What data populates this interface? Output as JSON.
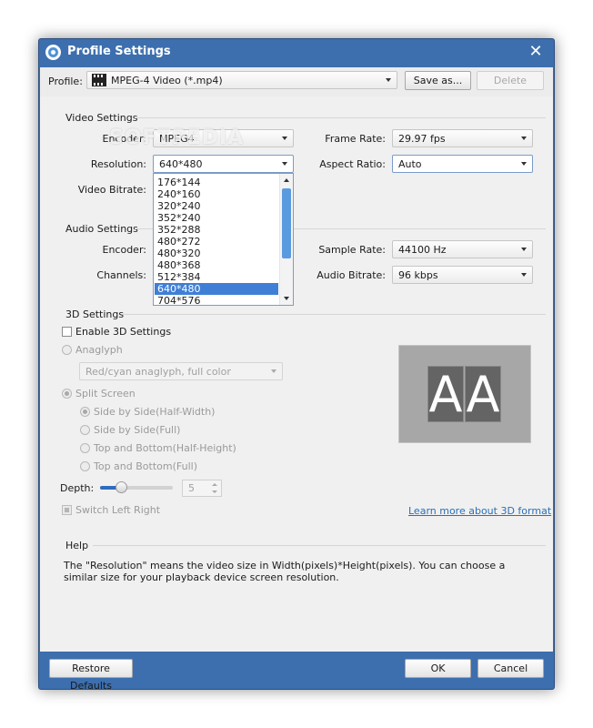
{
  "window": {
    "title": "Profile Settings",
    "close_glyph": "✕"
  },
  "profile": {
    "label": "Profile:",
    "value": "MPEG-4 Video (*.mp4)",
    "save_as": "Save as...",
    "delete": "Delete"
  },
  "video": {
    "section_title": "Video Settings",
    "encoder_label": "Encoder:",
    "encoder_value": "MPEG4",
    "resolution_label": "Resolution:",
    "resolution_value": "640*480",
    "bitrate_label": "Video Bitrate:",
    "frame_rate_label": "Frame Rate:",
    "frame_rate_value": "29.97 fps",
    "aspect_label": "Aspect Ratio:",
    "aspect_value": "Auto"
  },
  "resolution_dropdown": {
    "options": [
      "176*144",
      "240*160",
      "320*240",
      "352*240",
      "352*288",
      "480*272",
      "480*320",
      "480*368",
      "512*384",
      "640*480",
      "704*576"
    ],
    "selected": "640*480"
  },
  "audio": {
    "section_title": "Audio Settings",
    "encoder_label": "Encoder:",
    "channels_label": "Channels:",
    "sample_rate_label": "Sample Rate:",
    "sample_rate_value": "44100 Hz",
    "bitrate_label": "Audio Bitrate:",
    "bitrate_value": "96 kbps"
  },
  "three_d": {
    "section_title": "3D Settings",
    "enable_label": "Enable 3D Settings",
    "anaglyph_label": "Anaglyph",
    "anaglyph_value": "Red/cyan anaglyph, full color",
    "split_screen_label": "Split Screen",
    "split_options": [
      "Side by Side(Half-Width)",
      "Side by Side(Full)",
      "Top and Bottom(Half-Height)",
      "Top and Bottom(Full)"
    ],
    "depth_label": "Depth:",
    "depth_value": "5",
    "switch_label": "Switch Left Right",
    "learn_more": "Learn more about 3D format",
    "preview_letters": [
      "A",
      "A"
    ]
  },
  "help": {
    "section_title": "Help",
    "text": "The \"Resolution\" means the video size in Width(pixels)*Height(pixels).  You can choose a similar size for your playback device screen resolution."
  },
  "footer": {
    "restore_defaults": "Restore Defaults",
    "ok": "OK",
    "cancel": "Cancel"
  },
  "watermark": "SOFTPEDIA",
  "colors": {
    "titlebar": "#3d6fae",
    "selection": "#3f7fd6",
    "link": "#2a6fb8"
  }
}
